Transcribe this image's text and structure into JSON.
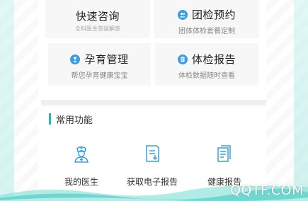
{
  "cards": [
    {
      "title": "快速咨询",
      "subtitle": "全科医生答疑解惑",
      "icon": "none"
    },
    {
      "title": "团检预约",
      "subtitle": "团体体检套餐定制",
      "icon": "group-icon"
    },
    {
      "title": "孕育管理",
      "subtitle": "帮您孕育健康宝宝",
      "icon": "baby-icon"
    },
    {
      "title": "体检报告",
      "subtitle": "体检数据随时查看",
      "icon": "report-icon"
    }
  ],
  "section": {
    "title": "常用功能"
  },
  "functions": [
    {
      "label": "我的医生",
      "icon": "doctor-icon"
    },
    {
      "label": "获取电子报告",
      "icon": "e-report-icon"
    },
    {
      "label": "健康报告",
      "icon": "health-report-icon"
    }
  ],
  "watermark": "QQTF.COM",
  "colors": {
    "accent": "#2fb7b0",
    "icon_blue": "#3b9ee0",
    "card_bg": "#f7f7f7"
  }
}
